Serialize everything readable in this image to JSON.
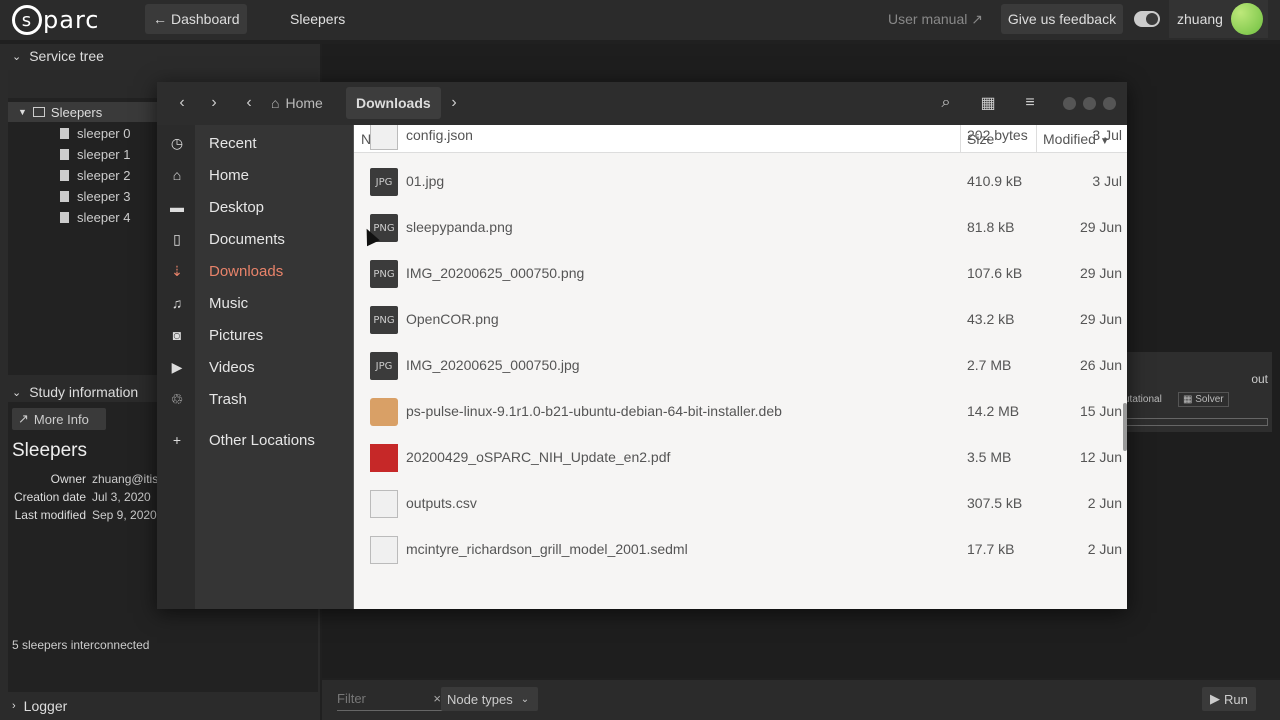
{
  "topbar": {
    "logo_text": "parc",
    "logo_s": "s",
    "dashboard_label": "Dashboard",
    "study_title": "Sleepers",
    "user_manual": "User manual",
    "feedback": "Give us feedback",
    "username": "zhuang"
  },
  "left": {
    "service_tree_label": "Service tree",
    "root": "Sleepers",
    "nodes": [
      "sleeper 0",
      "sleeper 1",
      "sleeper 2",
      "sleeper 3",
      "sleeper 4"
    ],
    "study_info_label": "Study information",
    "more_info": "More Info",
    "info_title": "Sleepers",
    "owner_key": "Owner",
    "owner_val": "zhuang@itis",
    "created_key": "Creation date",
    "created_val": "Jul 3, 2020",
    "modified_key": "Last modified",
    "modified_val": "Sep 9, 2020",
    "description": "5 sleepers interconnected",
    "logger_label": "Logger"
  },
  "workbench": {
    "node_out": "out",
    "node_tag1": "utational",
    "node_tag2": "Solver",
    "filter_placeholder": "Filter",
    "node_types": "Node types",
    "run": "Run"
  },
  "dialog": {
    "crumbs": [
      "Home",
      "Downloads"
    ],
    "places": [
      "Recent",
      "Home",
      "Desktop",
      "Documents",
      "Downloads",
      "Music",
      "Pictures",
      "Videos",
      "Trash",
      "Other Locations"
    ],
    "columns": {
      "name": "Name",
      "size": "Size",
      "modified": "Modified"
    },
    "files": [
      {
        "name": "config.json",
        "size": "202 bytes",
        "mod": "3 Jul",
        "type": "doc"
      },
      {
        "name": "01.jpg",
        "size": "410.9 kB",
        "mod": "3 Jul",
        "type": "JPG"
      },
      {
        "name": "sleepypanda.png",
        "size": "81.8 kB",
        "mod": "29 Jun",
        "type": "PNG"
      },
      {
        "name": "IMG_20200625_000750.png",
        "size": "107.6 kB",
        "mod": "29 Jun",
        "type": "PNG"
      },
      {
        "name": "OpenCOR.png",
        "size": "43.2 kB",
        "mod": "29 Jun",
        "type": "PNG"
      },
      {
        "name": "IMG_20200625_000750.jpg",
        "size": "2.7 MB",
        "mod": "26 Jun",
        "type": "JPG"
      },
      {
        "name": "ps-pulse-linux-9.1r1.0-b21-ubuntu-debian-64-bit-installer.deb",
        "size": "14.2 MB",
        "mod": "15 Jun",
        "type": "pkg"
      },
      {
        "name": "20200429_oSPARC_NIH_Update_en2.pdf",
        "size": "3.5 MB",
        "mod": "12 Jun",
        "type": "pdf"
      },
      {
        "name": "outputs.csv",
        "size": "307.5 kB",
        "mod": "2 Jun",
        "type": "doc"
      },
      {
        "name": "mcintyre_richardson_grill_model_2001.sedml",
        "size": "17.7 kB",
        "mod": "2 Jun",
        "type": "code"
      }
    ]
  }
}
